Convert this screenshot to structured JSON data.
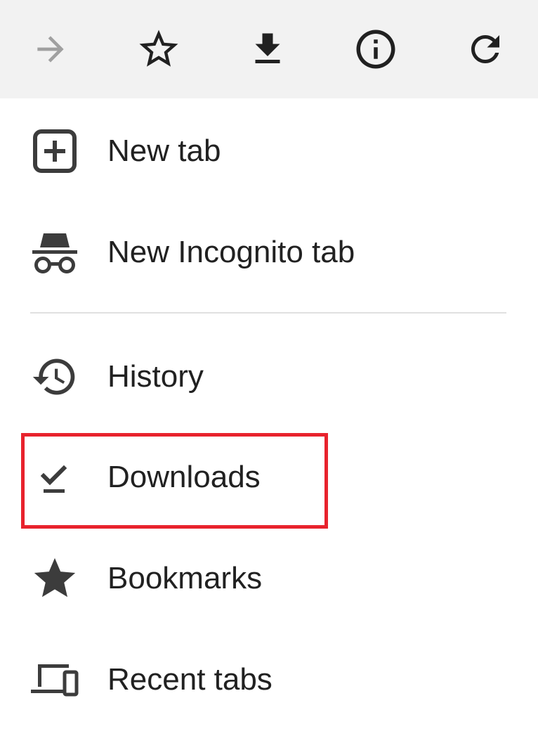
{
  "toolbar": {
    "buttons": [
      {
        "name": "forward",
        "icon": "forward-arrow-icon",
        "enabled": false
      },
      {
        "name": "bookmark",
        "icon": "star-outline-icon",
        "enabled": true
      },
      {
        "name": "download",
        "icon": "download-icon",
        "enabled": true
      },
      {
        "name": "page-info",
        "icon": "info-icon",
        "enabled": true
      },
      {
        "name": "refresh",
        "icon": "refresh-icon",
        "enabled": true
      }
    ]
  },
  "menu": {
    "items": [
      {
        "label": "New tab",
        "icon": "plus-box-icon"
      },
      {
        "label": "New Incognito tab",
        "icon": "incognito-icon"
      },
      {
        "label": "History",
        "icon": "history-icon"
      },
      {
        "label": "Downloads",
        "icon": "download-done-icon",
        "highlighted": true
      },
      {
        "label": "Bookmarks",
        "icon": "star-filled-icon"
      },
      {
        "label": "Recent tabs",
        "icon": "devices-icon"
      }
    ]
  },
  "colors": {
    "toolbar_bg": "#f2f2f2",
    "icon": "#212121",
    "icon_menu": "#3c3c3c",
    "disabled_icon": "#a0a0a0",
    "highlight_border": "#e8232d",
    "divider": "#e0e0e0"
  }
}
